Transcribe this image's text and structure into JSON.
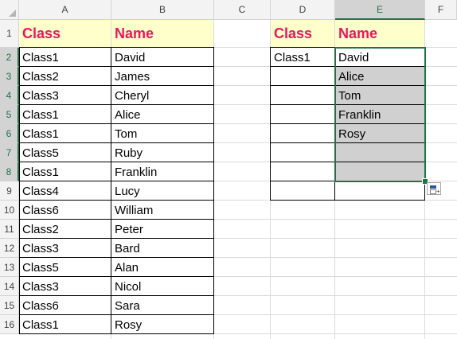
{
  "columns": [
    "A",
    "B",
    "C",
    "D",
    "E",
    "F"
  ],
  "rows": [
    "1",
    "2",
    "3",
    "4",
    "5",
    "6",
    "7",
    "8",
    "9",
    "10",
    "11",
    "12",
    "13",
    "14",
    "15",
    "16"
  ],
  "table_left": {
    "header": {
      "class": "Class",
      "name": "Name"
    },
    "rows": [
      {
        "class": "Class1",
        "name": "David"
      },
      {
        "class": "Class2",
        "name": "James"
      },
      {
        "class": "Class3",
        "name": "Cheryl"
      },
      {
        "class": "Class1",
        "name": "Alice"
      },
      {
        "class": "Class1",
        "name": "Tom"
      },
      {
        "class": "Class5",
        "name": "Ruby"
      },
      {
        "class": "Class1",
        "name": "Franklin"
      },
      {
        "class": "Class4",
        "name": "Lucy"
      },
      {
        "class": "Class6",
        "name": "William"
      },
      {
        "class": "Class2",
        "name": "Peter"
      },
      {
        "class": "Class3",
        "name": "Bard"
      },
      {
        "class": "Class5",
        "name": "Alan"
      },
      {
        "class": "Class3",
        "name": "Nicol"
      },
      {
        "class": "Class6",
        "name": "Sara"
      },
      {
        "class": "Class1",
        "name": "Rosy"
      }
    ]
  },
  "table_right": {
    "header": {
      "class": "Class",
      "name": "Name"
    },
    "lookup_class": "Class1",
    "results": [
      "David",
      "Alice",
      "Tom",
      "Franklin",
      "Rosy",
      "",
      "",
      ""
    ]
  },
  "colors": {
    "header_text": "#e8175d",
    "header_fill": "#ffffcc",
    "selection_fill": "#d0d0d0",
    "selection_border": "#217346"
  },
  "icons": {
    "quick_analysis": "quick-analysis-icon"
  }
}
